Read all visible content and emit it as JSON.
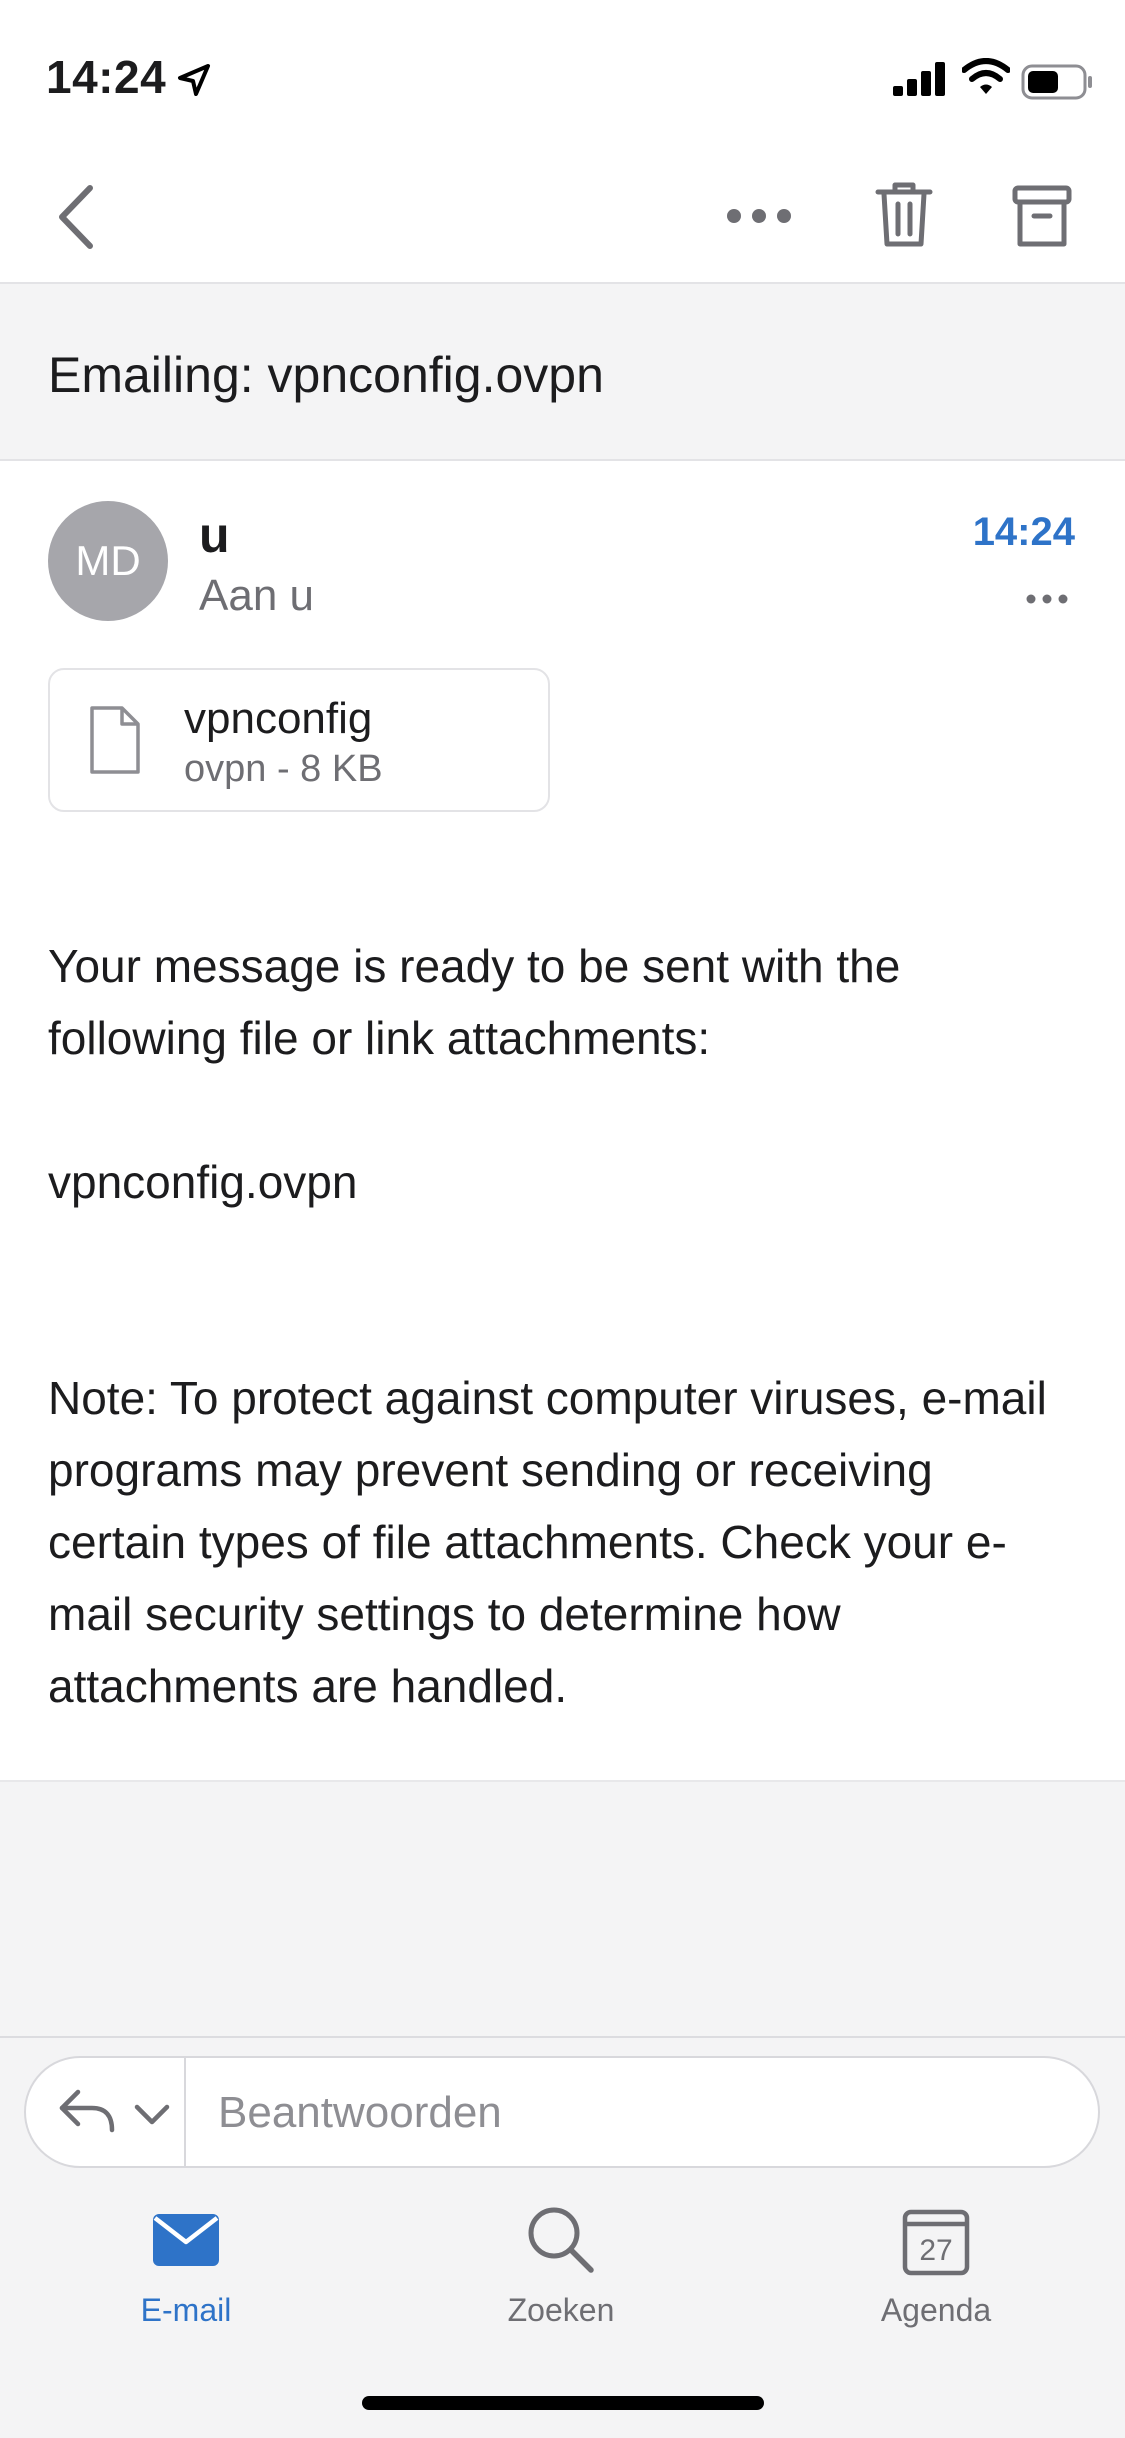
{
  "status_bar": {
    "time": "14:24"
  },
  "email": {
    "subject": "Emailing: vpnconfig.ovpn",
    "avatar_initials": "MD",
    "sender": "u",
    "recipient_line": "Aan u",
    "time": "14:24",
    "attachment": {
      "name": "vpnconfig",
      "meta": "ovpn - 8 KB"
    },
    "body": {
      "intro": "Your message is ready to be sent with the following file or link attachments:",
      "filename": "vpnconfig.ovpn",
      "note": "Note: To protect against computer viruses, e-mail programs may prevent sending or receiving certain types of file attachments. Check your e-mail security settings to determine how attachments are handled."
    }
  },
  "reply": {
    "placeholder": "Beantwoorden"
  },
  "tabs": [
    {
      "label": "E-mail",
      "icon": "mail-icon",
      "active": true
    },
    {
      "label": "Zoeken",
      "icon": "search-icon",
      "active": false
    },
    {
      "label": "Agenda",
      "icon": "calendar-icon",
      "active": false,
      "calendar_day": "27"
    }
  ],
  "colors": {
    "accent": "#2e73c8",
    "inactive": "#6e6e73",
    "background_gray": "#f4f4f5"
  }
}
